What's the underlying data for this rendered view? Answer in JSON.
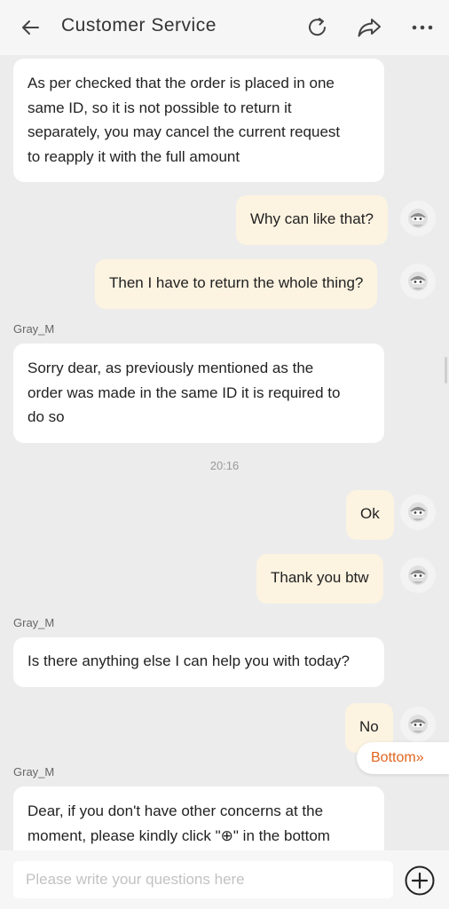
{
  "header": {
    "title": "Customer Service",
    "icons": [
      "back-arrow-icon",
      "refresh-icon",
      "share-icon",
      "more-icon"
    ]
  },
  "messages": [
    {
      "from": "agent",
      "text": [
        "As per checked that the order is placed in one",
        "same ID, so it is not possible to return it",
        "separately, you may cancel the current request",
        "to reapply it with the full amount"
      ]
    },
    {
      "from": "me",
      "text": "Why can like that?"
    },
    {
      "from": "me",
      "text": "Then I have to return the whole thing?"
    },
    {
      "sender": "Gray_M",
      "from": "agent",
      "text": [
        "Sorry dear, as previously mentioned as the",
        "order was made in the same ID it is required to",
        "do so"
      ]
    },
    {
      "timestamp": "20:16"
    },
    {
      "from": "me",
      "text": "Ok"
    },
    {
      "from": "me",
      "text": "Thank you btw"
    },
    {
      "sender": "Gray_M",
      "from": "agent",
      "text": "Is there anything else I can help you with today?"
    },
    {
      "from": "me",
      "text": "No"
    },
    {
      "sender": "Gray_M",
      "from": "agent",
      "text": [
        "Dear, if you don't have other concerns at the",
        "moment, please kindly click \"⊕\" in the bottom"
      ]
    }
  ],
  "jump": {
    "label": "Bottom»"
  },
  "composer": {
    "placeholder": "Please write your questions here"
  },
  "colors": {
    "accent": "#e0641e",
    "my_bubble": "#fcf3e1",
    "agent_bubble": "#ffffff",
    "background": "#ececec"
  }
}
